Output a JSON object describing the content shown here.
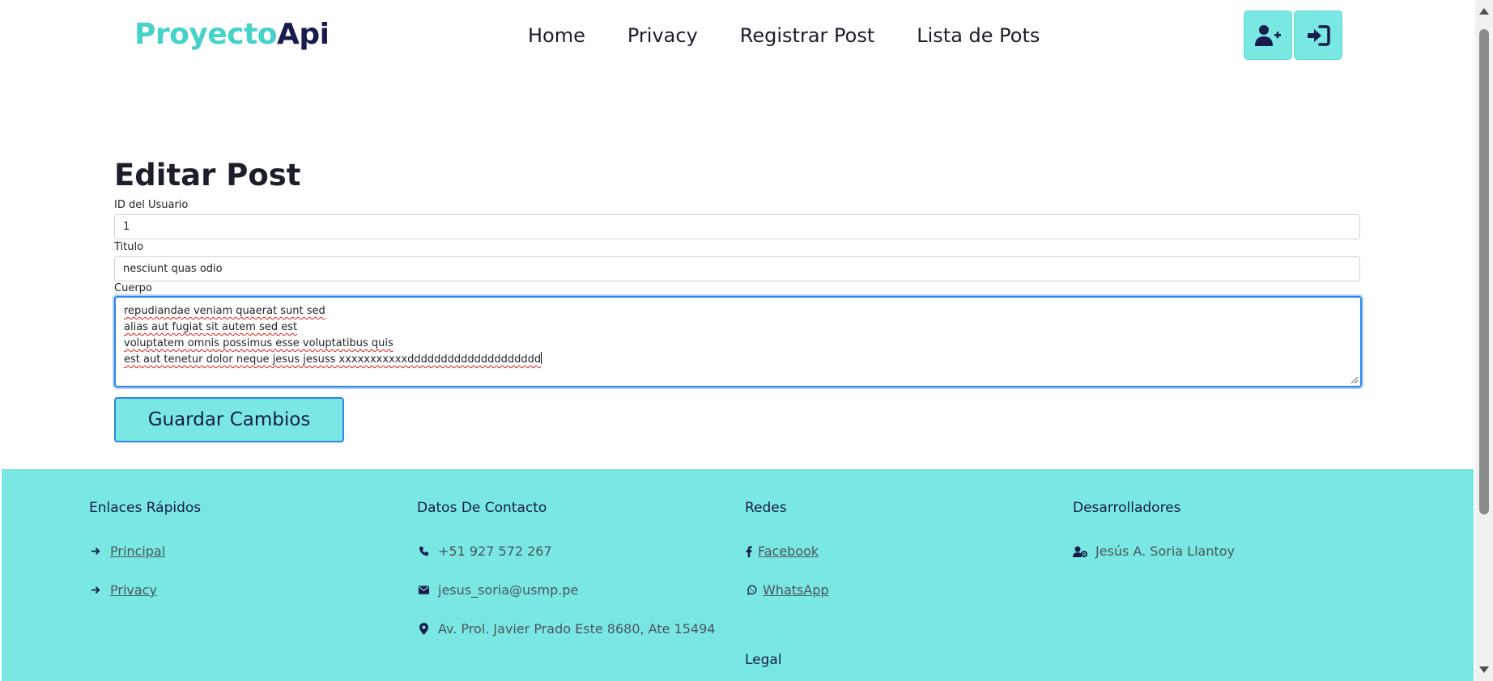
{
  "header": {
    "brand_part1": "Proyecto",
    "brand_part2": "Api",
    "nav": [
      {
        "label": "Home"
      },
      {
        "label": "Privacy"
      },
      {
        "label": "Registrar Post"
      },
      {
        "label": "Lista de Pots"
      }
    ],
    "buttons": [
      {
        "icon": "user-plus-icon"
      },
      {
        "icon": "sign-in-icon"
      }
    ]
  },
  "form": {
    "title": "Editar Post",
    "user_id_label": "ID del Usuario",
    "user_id_value": "1",
    "title_label": "Titulo",
    "title_value": "nesciunt quas odio",
    "body_label": "Cuerpo",
    "body_lines": [
      "repudiandae veniam quaerat sunt sed",
      "alias aut fugiat sit autem sed est",
      "voluptatem omnis possimus esse voluptatibus quis",
      "est aut tenetur dolor neque jesus jesuss xxxxxxxxxxxdddddddddddddddddddd"
    ],
    "save_label": "Guardar Cambios"
  },
  "footer": {
    "quick_links": {
      "heading": "Enlaces Rápidos",
      "items": [
        {
          "label": " Principal",
          "icon": "arrow-right-icon"
        },
        {
          "label": " Privacy",
          "icon": "arrow-right-icon"
        }
      ]
    },
    "contact": {
      "heading": "Datos De Contacto",
      "items": [
        {
          "label": "+51 927 572 267",
          "icon": "phone-icon"
        },
        {
          "label": "jesus_soria@usmp.pe",
          "icon": "envelope-icon"
        },
        {
          "label": "Av. Prol. Javier Prado Este 8680, Ate 15494",
          "icon": "map-marker-icon"
        }
      ]
    },
    "social": {
      "heading": "Redes",
      "items": [
        {
          "label": " Facebook",
          "icon": "facebook-icon"
        },
        {
          "label": " WhatsApp",
          "icon": "whatsapp-icon"
        }
      ],
      "legal_heading": "Legal"
    },
    "developers": {
      "heading": "Desarrolladores",
      "items": [
        {
          "label": "Jesús A. Soria Llantoy",
          "icon": "user-cog-icon"
        }
      ]
    }
  },
  "colors": {
    "accent": "#7ae8e2",
    "brand_light": "#45d3c9",
    "brand_dark": "#171b4d",
    "focus_border": "#2f86e8"
  }
}
